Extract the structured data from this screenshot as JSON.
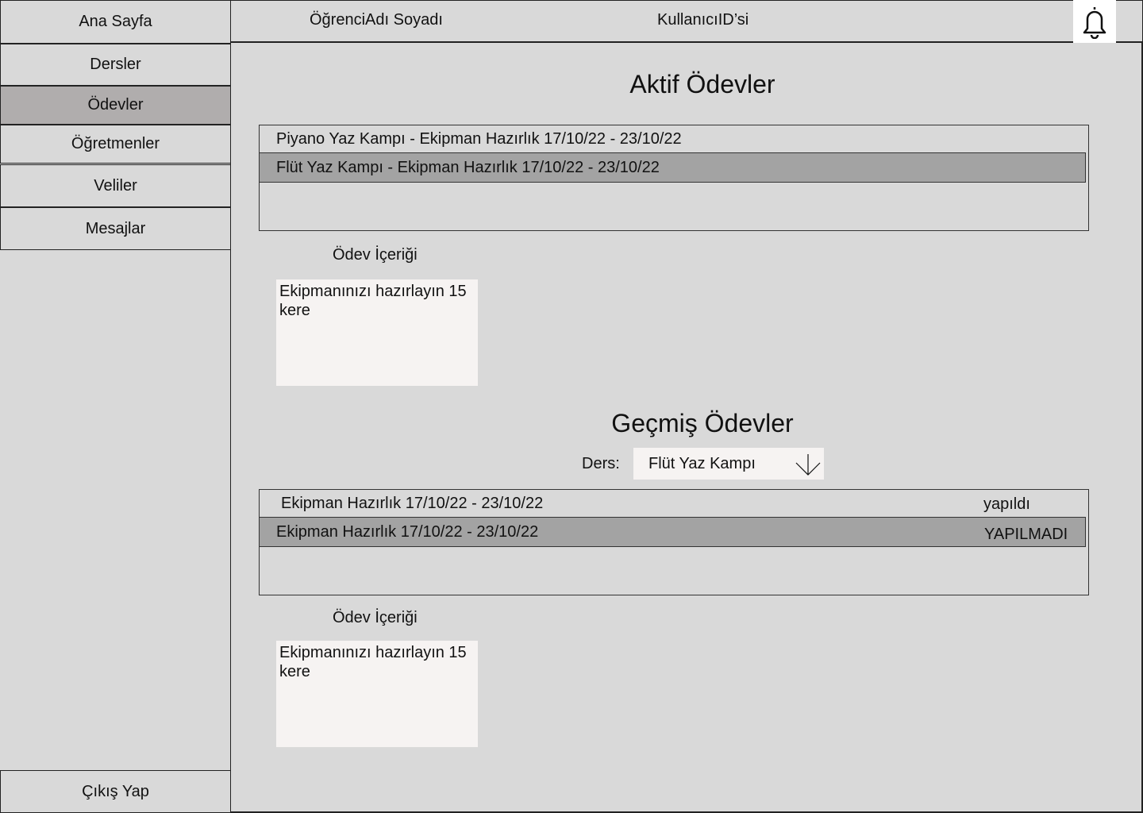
{
  "sidebar": {
    "home": "Ana Sayfa",
    "items": [
      "Dersler",
      "Ödevler",
      "Öğretmenler",
      "Veliler",
      "Mesajlar"
    ],
    "logout": "Çıkış Yap"
  },
  "header": {
    "student_name": "ÖğrenciAdı Soyadı",
    "user_id": "KullanıcıID’si",
    "notification_icon": "bell-icon"
  },
  "active": {
    "title": "Aktif Ödevler",
    "items": [
      "Piyano Yaz Kampı - Ekipman Hazırlık 17/10/22 - 23/10/22",
      "Flüt Yaz Kampı - Ekipman Hazırlık 17/10/22 - 23/10/22"
    ],
    "content_label": "Ödev İçeriği",
    "content": "Ekipmanınızı hazırlayın 15 kere"
  },
  "past": {
    "title": "Geçmiş Ödevler",
    "course_label": "Ders:",
    "course_value": "Flüt Yaz Kampı",
    "items": [
      {
        "name": "Ekipman Hazırlık 17/10/22 - 23/10/22",
        "status": "yapıldı"
      },
      {
        "name": "Ekipman Hazırlık 17/10/22 - 23/10/22",
        "status": "YAPILMADI"
      }
    ],
    "content_label": "Ödev İçeriği",
    "content": "Ekipmanınızı hazırlayın 15 kere"
  }
}
